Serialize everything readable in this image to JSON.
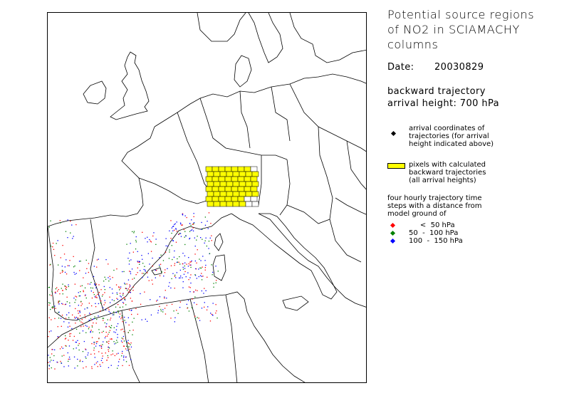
{
  "title_lines": [
    "Potential source regions",
    "of NO2 in SCIAMACHY columns"
  ],
  "date": {
    "label": "Date:",
    "value": "20030829"
  },
  "trajectory": {
    "line1": "backward trajectory",
    "line2": "arrival height:  700 hPa"
  },
  "legend": {
    "arrival": {
      "text": [
        "arrival coordinates of",
        "trajectories (for arrival",
        "height indicated above)"
      ],
      "color": "#000000"
    },
    "pixels": {
      "text": [
        "pixels with calculated",
        "backward trajectories",
        "(all arrival heights)"
      ],
      "color": "#ffff00"
    },
    "timesteps_intro": [
      "four hourly trajectory time",
      "steps with a distance from",
      "model ground of"
    ],
    "pressure_classes": [
      {
        "range": "     <  50 hPa",
        "color": "#ff0000"
      },
      {
        "range": "50  -  100 hPa",
        "color": "#008000"
      },
      {
        "range": "100  -  150 hPa",
        "color": "#0000ff"
      }
    ]
  }
}
